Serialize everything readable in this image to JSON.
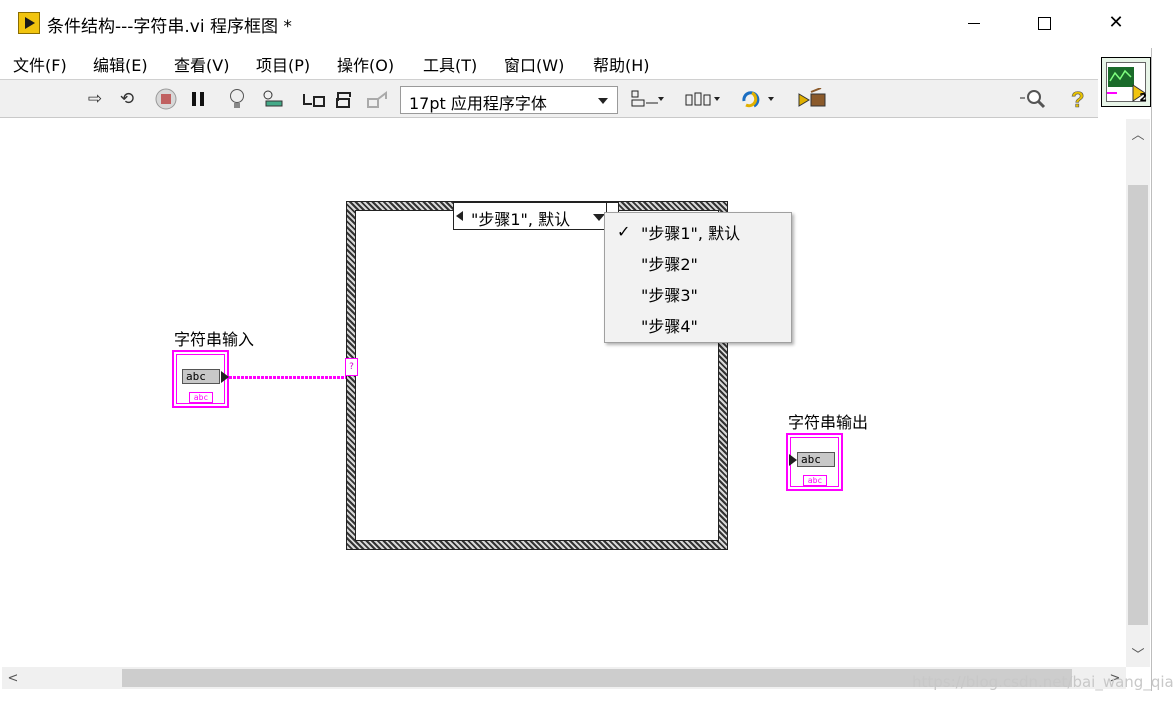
{
  "window": {
    "title": "条件结构---字符串.vi 程序框图 *",
    "controls": {
      "minimize": "—",
      "maximize": "☐",
      "close": "✕"
    }
  },
  "menu": [
    "文件(F)",
    "编辑(E)",
    "查看(V)",
    "项目(P)",
    "操作(O)",
    "工具(T)",
    "窗口(W)",
    "帮助(H)"
  ],
  "toolbar": {
    "font": "17pt 应用程序字体",
    "icons": [
      "run-arrow-icon",
      "run-continuously-icon",
      "abort-icon",
      "pause-icon",
      "highlight-execution-icon",
      "retain-wire-values-icon",
      "step-into-icon",
      "step-over-icon",
      "step-out-icon",
      "align-objects-icon",
      "distribute-objects-icon",
      "reorder-icon",
      "cleanup-diagram-icon",
      "search-icon",
      "help-icon"
    ],
    "vi_icon_number": "2"
  },
  "case_structure": {
    "selector_value": "\"步骤1\", 默认",
    "tunnel_label": "?",
    "menu_items": [
      {
        "label": "\"步骤1\", 默认",
        "checked": true
      },
      {
        "label": "\"步骤2\"",
        "checked": false
      },
      {
        "label": "\"步骤3\"",
        "checked": false
      },
      {
        "label": "\"步骤4\"",
        "checked": false
      }
    ],
    "check_mark": "✓"
  },
  "terminals": {
    "input": {
      "label": "字符串输入",
      "field": "abc",
      "tag": "abc"
    },
    "output": {
      "label": "字符串输出",
      "field": "abc",
      "tag": "abc"
    }
  },
  "watermark": "https://blog.csdn.net/bai_wang_qiao"
}
